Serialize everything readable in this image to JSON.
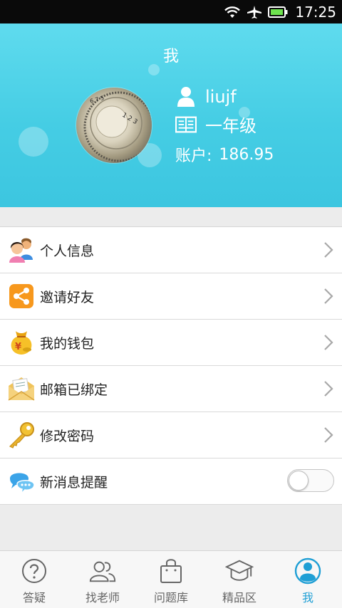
{
  "status_bar": {
    "time": "17:25",
    "wifi_icon": "wifi-icon",
    "airplane_icon": "airplane-icon",
    "battery_icon": "battery-icon"
  },
  "header": {
    "title": "我"
  },
  "profile": {
    "username": "liujf",
    "grade": "一年级",
    "balance_label": "账户:",
    "balance_value": "186.95",
    "user_icon": "user-icon",
    "grade_icon": "book-icon"
  },
  "menu": {
    "items": [
      {
        "label": "个人信息",
        "icon": "contacts-icon"
      },
      {
        "label": "邀请好友",
        "icon": "share-icon"
      },
      {
        "label": "我的钱包",
        "icon": "money-bag-icon"
      },
      {
        "label": "邮箱已绑定",
        "icon": "envelope-icon"
      },
      {
        "label": "修改密码",
        "icon": "key-icon"
      },
      {
        "label": "新消息提醒",
        "icon": "chat-bubbles-icon",
        "toggle_on": false
      }
    ]
  },
  "tabbar": {
    "tabs": [
      {
        "label": "答疑",
        "icon": "question-icon",
        "active": false
      },
      {
        "label": "找老师",
        "icon": "teachers-icon",
        "active": false
      },
      {
        "label": "问题库",
        "icon": "bag-icon",
        "active": false
      },
      {
        "label": "精品区",
        "icon": "graduation-cap-icon",
        "active": false
      },
      {
        "label": "我",
        "icon": "profile-icon",
        "active": true
      }
    ]
  },
  "colors": {
    "accent": "#1f9fd5",
    "header_bg": "#4dd2e8",
    "toggle_off": "#fafafa"
  }
}
